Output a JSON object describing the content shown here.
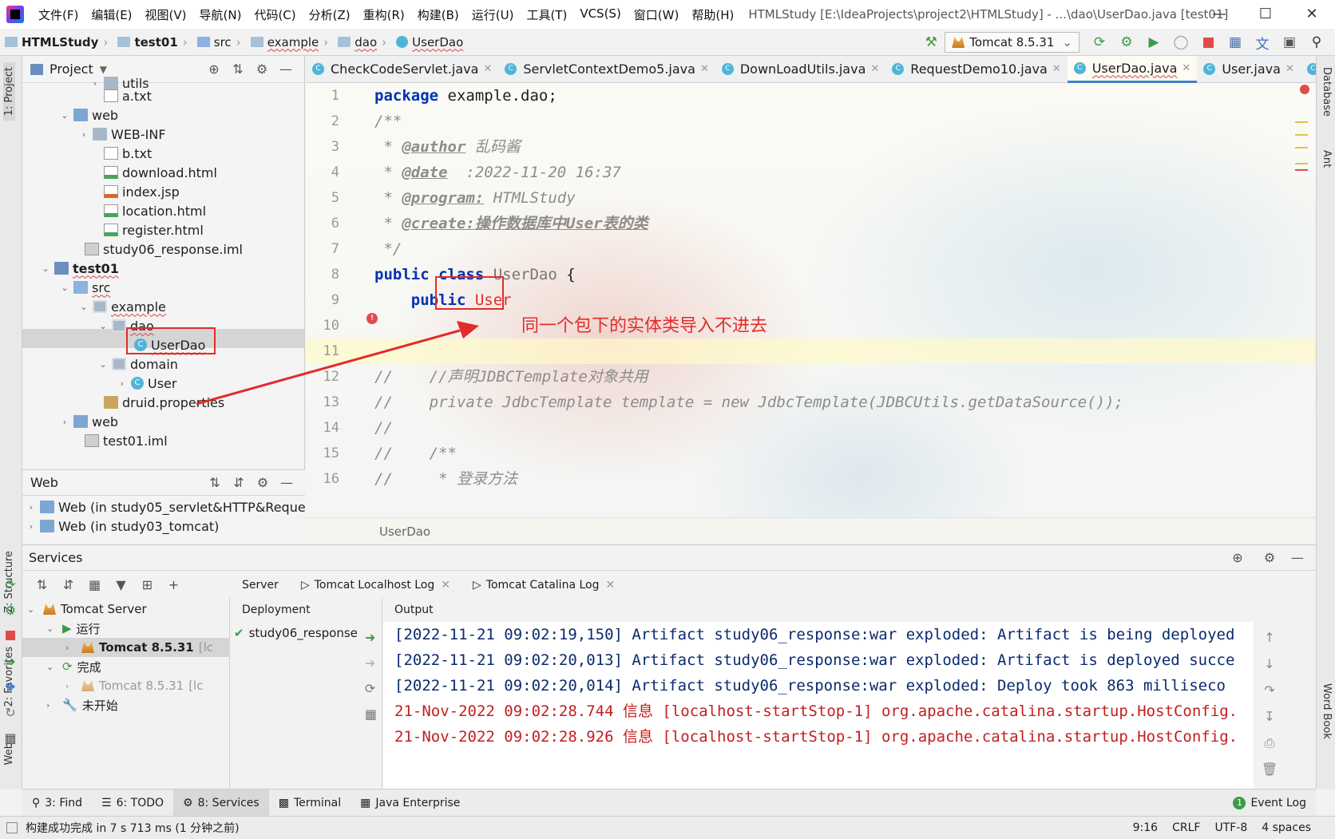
{
  "app": {
    "menu": [
      "文件(F)",
      "编辑(E)",
      "视图(V)",
      "导航(N)",
      "代码(C)",
      "分析(Z)",
      "重构(R)",
      "构建(B)",
      "运行(U)",
      "工具(T)",
      "VCS(S)",
      "窗口(W)",
      "帮助(H)"
    ],
    "window_title": "HTMLStudy [E:\\IdeaProjects\\project2\\HTMLStudy] - ...\\dao\\UserDao.java [test01]"
  },
  "navbar": {
    "breadcrumbs": [
      "HTMLStudy",
      "test01",
      "src",
      "example",
      "dao",
      "UserDao"
    ],
    "run_config": "Tomcat 8.5.31"
  },
  "left_stripe": {
    "project": "1: Project",
    "structure": "Z: Structure",
    "favorites": "2: Favorites",
    "web": "Web"
  },
  "right_stripe": {
    "database": "Database",
    "ant": "Ant",
    "wordbook": "Word Book"
  },
  "project": {
    "title": "Project",
    "tree": [
      "utils",
      "a.txt",
      "web",
      "WEB-INF",
      "b.txt",
      "download.html",
      "index.jsp",
      "location.html",
      "register.html",
      "study06_response.iml",
      "test01",
      "src",
      "example",
      "dao",
      "UserDao",
      "domain",
      "User",
      "druid.properties",
      "web",
      "test01.iml"
    ]
  },
  "web_panel": {
    "title": "Web",
    "items": [
      "Web (in study05_servlet&HTTP&Request)",
      "Web (in study03_tomcat)"
    ]
  },
  "editor": {
    "tabs": [
      "CheckCodeServlet.java",
      "ServletContextDemo5.java",
      "DownLoadUtils.java",
      "RequestDemo10.java",
      "UserDao.java",
      "User.java",
      "C"
    ],
    "line_numbers": [
      "1",
      "2",
      "3",
      "4",
      "5",
      "6",
      "7",
      "8",
      "9",
      "10",
      "11",
      "12",
      "13",
      "14",
      "15",
      "16"
    ],
    "code": {
      "l1_kw": "package",
      "l1_rest": " example.dao;",
      "l2": "/**",
      "l3_star": " * ",
      "l3_tag": "@author",
      "l3_val": " 乱码酱",
      "l4_star": " * ",
      "l4_tag": "@date",
      "l4_val": "  :2022-11-20 16:37",
      "l5_star": " * ",
      "l5_tag": "@program:",
      "l5_val": " HTMLStudy",
      "l6_star": " * ",
      "l6_tag": "@create:操作数据库中User表的类",
      "l7": " */",
      "l8_kw": "public class",
      "l8_name": " UserDao",
      "l8_brace": " {",
      "l9_kw": "    public",
      "l9_err": " User",
      "l12": "//    //声明JDBCTemplate对象共用",
      "l13": "//    private JdbcTemplate template = new JdbcTemplate(JDBCUtils.getDataSource());",
      "l14": "//",
      "l15": "//    /**",
      "l16": "//     * 登录方法"
    },
    "breadcrumb": "UserDao",
    "annotation": "同一个包下的实体类导入不进去"
  },
  "services": {
    "title": "Services",
    "tree": [
      "Tomcat Server",
      "运行",
      "Tomcat 8.5.31",
      "[lc",
      "完成",
      "Tomcat 8.5.31",
      "[lc",
      "未开始"
    ],
    "detail_tabs": [
      "Server",
      "Tomcat Localhost Log",
      "Tomcat Catalina Log"
    ],
    "deployment_label": "Deployment",
    "deployment_item": "study06_response",
    "output_label": "Output",
    "output": [
      "[2022-11-21 09:02:19,150] Artifact study06_response:war exploded: Artifact is being deployed",
      "[2022-11-21 09:02:20,013] Artifact study06_response:war exploded: Artifact is deployed succe",
      "[2022-11-21 09:02:20,014] Artifact study06_response:war exploded: Deploy took 863 milliseco",
      "21-Nov-2022 09:02:28.744 信息 [localhost-startStop-1] org.apache.catalina.startup.HostConfig.",
      "21-Nov-2022 09:02:28.926 信息 [localhost-startStop-1] org.apache.catalina.startup.HostConfig."
    ]
  },
  "tool_tabs": [
    "3: Find",
    "6: TODO",
    "8: Services",
    "Terminal",
    "Java Enterprise"
  ],
  "event_log": "Event Log",
  "event_count": "1",
  "status": {
    "message": "构建成功完成 in 7 s 713 ms (1 分钟之前)",
    "position": "9:16",
    "line_sep": "CRLF",
    "encoding": "UTF-8",
    "indent": "4 spaces"
  },
  "colors": {
    "accent": "#4083c9",
    "error": "#e32b2b",
    "keyword": "#0033b3"
  }
}
